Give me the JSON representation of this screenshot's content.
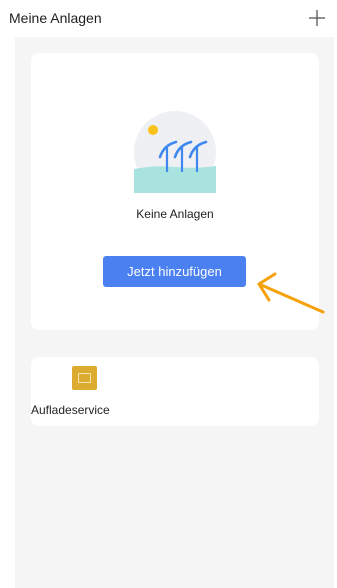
{
  "header": {
    "title": "Meine Anlagen",
    "add_icon": "plus-icon"
  },
  "empty_state": {
    "illustration_icon": "solar-panels-sun-icon",
    "message": "Keine Anlagen",
    "add_button_label": "Jetzt hinzufügen",
    "annotation_icon": "arrow-pointer-icon"
  },
  "services": [
    {
      "label": "Aufladeservice",
      "icon": "sim-card-icon"
    }
  ],
  "colors": {
    "primary": "#4a80f0",
    "annotation_arrow": "#f5a20a",
    "service_icon": "#dcab2f",
    "background": "#f5f5f5",
    "card": "#ffffff"
  }
}
